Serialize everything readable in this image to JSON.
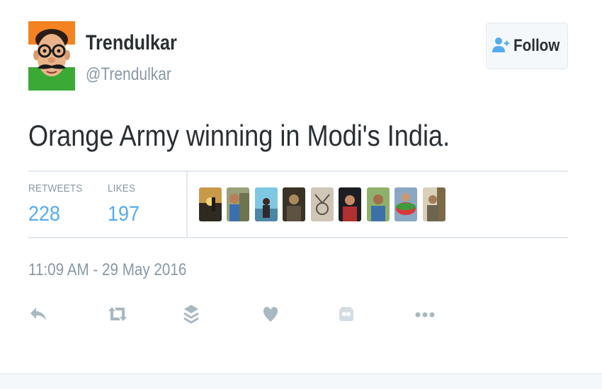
{
  "user": {
    "name": "Trendulkar",
    "handle": "@Trendulkar"
  },
  "follow_button": {
    "label": "Follow",
    "icon": "add-user-icon"
  },
  "tweet": {
    "text": "Orange Army winning in Modi's India."
  },
  "stats": {
    "retweets": {
      "label": "RETWEETS",
      "value": "228"
    },
    "likes": {
      "label": "LIKES",
      "value": "197"
    }
  },
  "likers_count_shown": 9,
  "timestamp": "11:09 AM - 29 May 2016",
  "actions": [
    "reply-icon",
    "retweet-icon",
    "buffer-icon",
    "like-icon",
    "vine-icon",
    "more-icon"
  ],
  "colors": {
    "accent": "#55acee",
    "text": "#292f33",
    "muted": "#8899a6",
    "border": "#e1e8ed",
    "action_icon": "#aab8c2"
  }
}
